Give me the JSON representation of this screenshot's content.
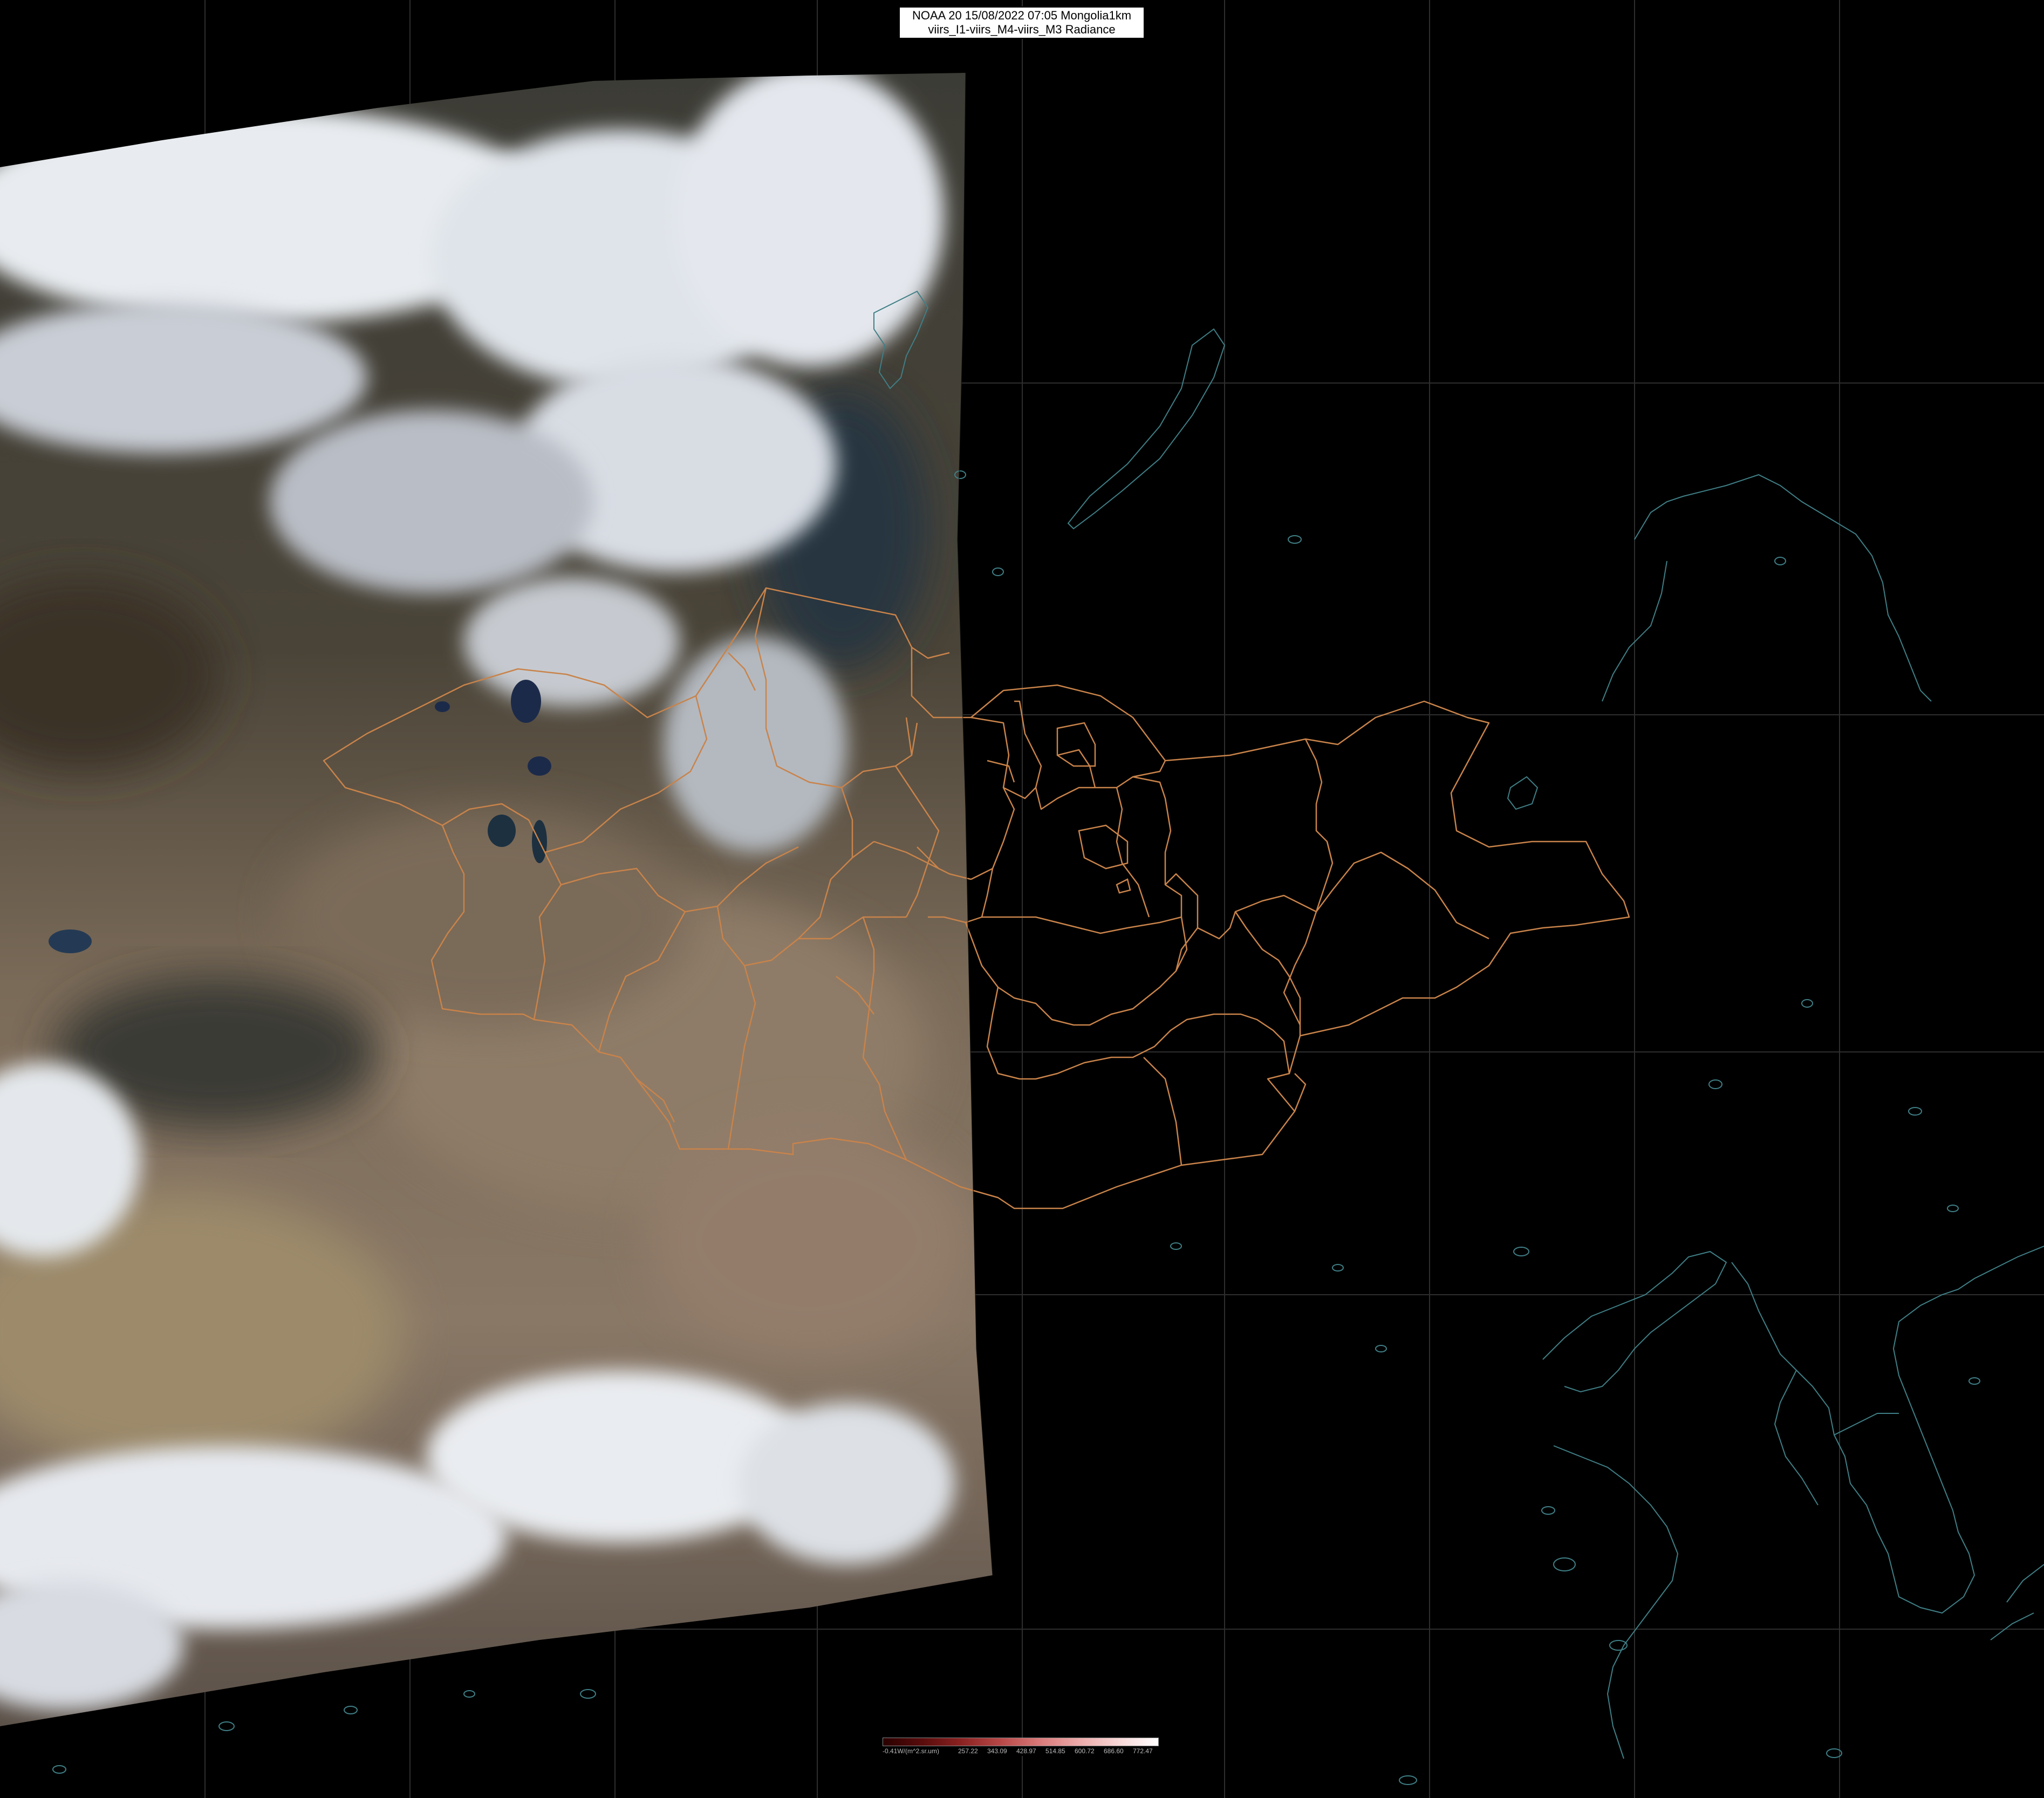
{
  "title": {
    "line1": "NOAA 20 15/08/2022 07:05 Mongolia1km",
    "line2": "viirs_I1-viirs_M4-viirs_M3 Radiance"
  },
  "colorbar": {
    "ticks": [
      "-0.41W/(m^2.sr.um)",
      "257.22",
      "343.09",
      "428.97",
      "514.85",
      "600.72",
      "686.60",
      "772.47"
    ],
    "colors": [
      "#2a0000",
      "#5a0c0c",
      "#8c2222",
      "#b84848",
      "#d97a7a",
      "#ecaaaa",
      "#f7d6d6",
      "#ffffff"
    ]
  },
  "colors": {
    "background": "#000000",
    "graticule": "#2e2e2e",
    "province_border": "#c9834a",
    "coastline": "#3f7f86",
    "cloud": "#e8ecf0",
    "desert": "#9c8a70",
    "steppe": "#4a4a40"
  }
}
